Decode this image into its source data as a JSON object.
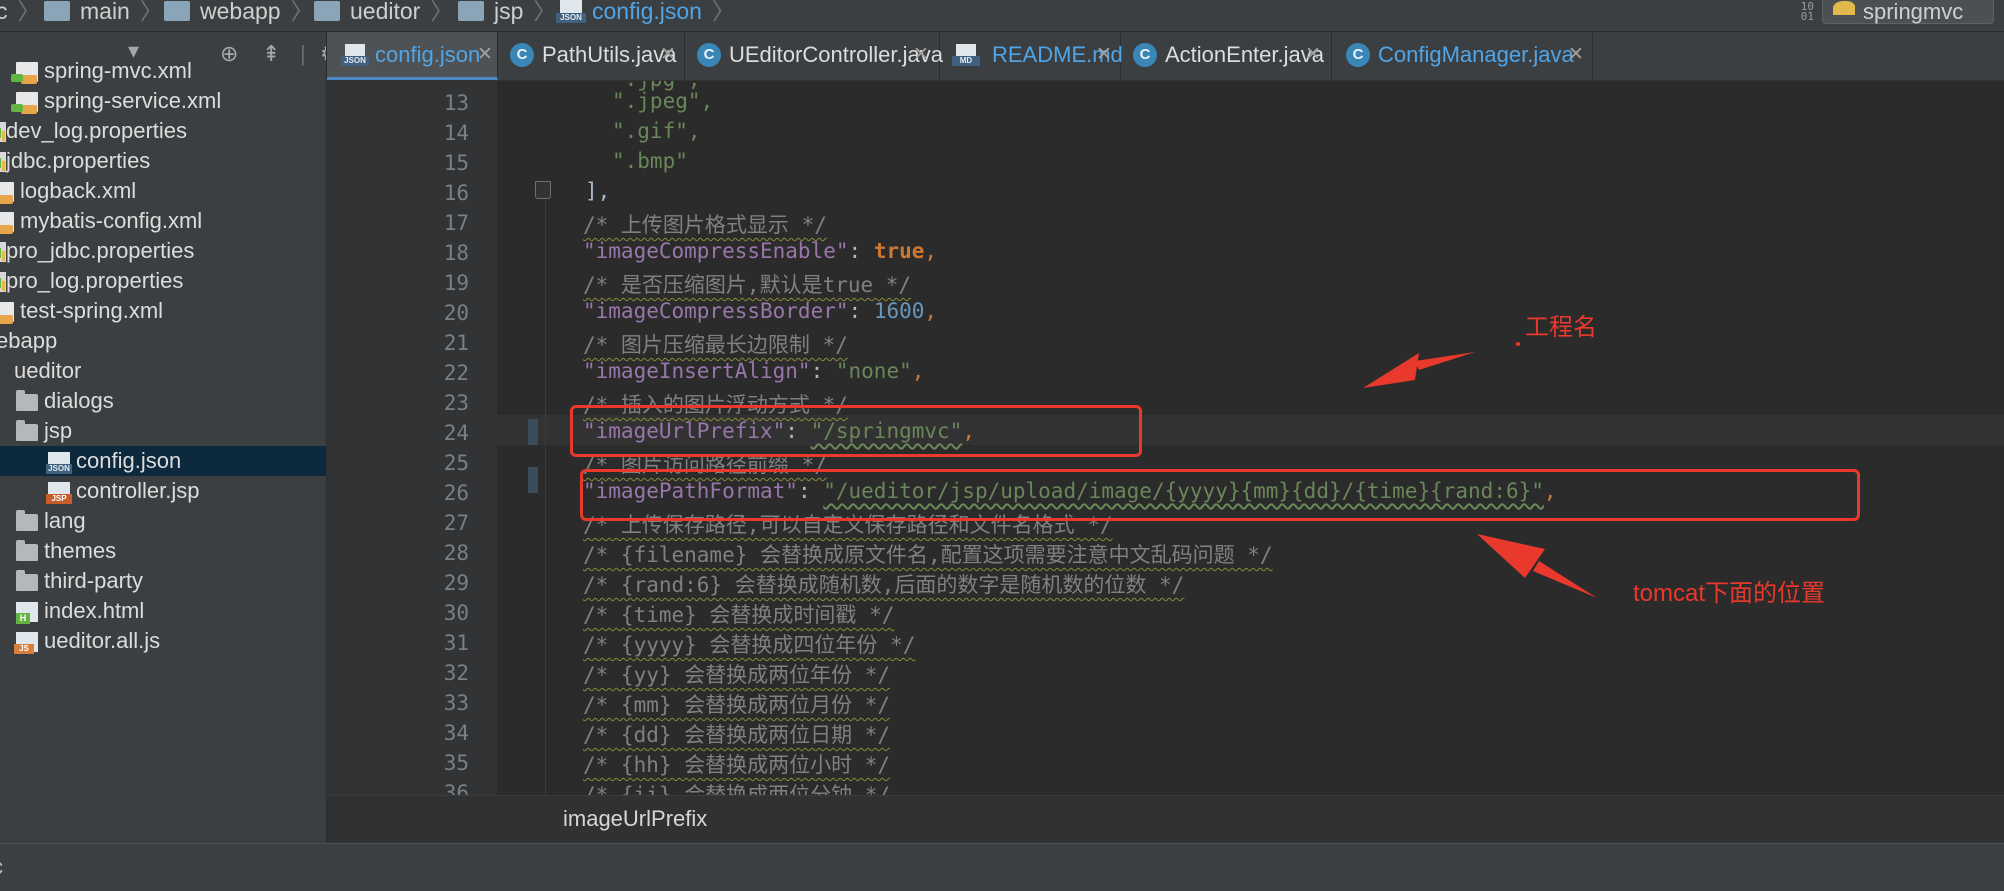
{
  "navbar": {
    "crumbs": [
      "c",
      "main",
      "webapp",
      "ueditor",
      "jsp",
      "config.json"
    ],
    "run_config": "springmvc"
  },
  "project_tree": [
    {
      "label": "spring-mvc.xml",
      "icon": "xml-file-icon",
      "indent": 1
    },
    {
      "label": "spring-service.xml",
      "icon": "xml-file-icon",
      "indent": 1
    },
    {
      "label": "dev_log.properties",
      "icon": "properties-file-icon",
      "indent": 0
    },
    {
      "label": "jdbc.properties",
      "icon": "properties-file-icon",
      "indent": 0
    },
    {
      "label": "logback.xml",
      "icon": "xml-file-icon",
      "indent": 0
    },
    {
      "label": "mybatis-config.xml",
      "icon": "xml-file-icon",
      "indent": 0
    },
    {
      "label": "pro_jdbc.properties",
      "icon": "properties-file-icon",
      "indent": 0
    },
    {
      "label": "pro_log.properties",
      "icon": "properties-file-icon",
      "indent": 0
    },
    {
      "label": "test-spring.xml",
      "icon": "xml-file-icon",
      "indent": 0
    },
    {
      "label": "ebapp",
      "icon": "none",
      "indent": -1
    },
    {
      "label": "ueditor",
      "icon": "none",
      "indent": 0
    },
    {
      "label": "dialogs",
      "icon": "folder-icon",
      "indent": 1
    },
    {
      "label": "jsp",
      "icon": "folder-icon",
      "indent": 1
    },
    {
      "label": "config.json",
      "icon": "json-file-icon",
      "indent": 2,
      "selected": true
    },
    {
      "label": "controller.jsp",
      "icon": "jsp-file-icon",
      "indent": 2
    },
    {
      "label": "lang",
      "icon": "folder-icon",
      "indent": 1
    },
    {
      "label": "themes",
      "icon": "folder-icon",
      "indent": 1
    },
    {
      "label": "third-party",
      "icon": "folder-icon",
      "indent": 1
    },
    {
      "label": "index.html",
      "icon": "html-file-icon",
      "indent": 1
    },
    {
      "label": "ueditor.all.js",
      "icon": "js-file-icon",
      "indent": 1
    }
  ],
  "tabs": [
    {
      "label": "config.json",
      "icon": "json-file-icon",
      "active": true
    },
    {
      "label": "PathUtils.java",
      "icon": "java-class-icon"
    },
    {
      "label": "UEditorController.java",
      "icon": "java-class-icon"
    },
    {
      "label": "README.md",
      "icon": "markdown-file-icon"
    },
    {
      "label": "ActionEnter.java",
      "icon": "java-class-icon"
    },
    {
      "label": "ConfigManager.java",
      "icon": "java-class-icon"
    }
  ],
  "code": {
    "line_numbers": [
      "13",
      "14",
      "15",
      "16",
      "17",
      "18",
      "19",
      "20",
      "21",
      "22",
      "23",
      "24",
      "25",
      "26",
      "27",
      "28",
      "29",
      "30",
      "31",
      "32",
      "33",
      "34",
      "35"
    ],
    "l13": "\".jpeg\",",
    "l14": "\".gif\",",
    "l15": "\".bmp\"",
    "l16": "],",
    "l17": "/* 上传图片格式显示 */",
    "l18_key": "\"imageCompressEnable\"",
    "l18_val": "true",
    "l19": "/* 是否压缩图片,默认是true */",
    "l20_key": "\"imageCompressBorder\"",
    "l20_val": "1600",
    "l21": "/* 图片压缩最长边限制 */",
    "l22_key": "\"imageInsertAlign\"",
    "l22_val": "\"none\"",
    "l23": "/* 插入的图片浮动方式 */",
    "l24_key": "\"imageUrlPrefix\"",
    "l24_val": "\"/springmvc\"",
    "l25": "/* 图片访问路径前缀 */",
    "l26_key": "\"imagePathFormat\"",
    "l26_val": "\"/ueditor/jsp/upload/image/{yyyy}{mm}{dd}/{time}{rand:6}\"",
    "l27": "/* 上传保存路径,可以自定义保存路径和文件名格式 */",
    "l28": "/* {filename} 会替换成原文件名,配置这项需要注意中文乱码问题 */",
    "l29": "/* {rand:6} 会替换成随机数,后面的数字是随机数的位数 */",
    "l30": "/* {time} 会替换成时间戳 */",
    "l31": "/* {yyyy} 会替换成四位年份 */",
    "l32": "/* {yy} 会替换成两位年份 */",
    "l33": "/* {mm} 会替换成两位月份 */",
    "l34": "/* {dd} 会替换成两位日期 */",
    "l35": "/* {hh} 会替换成两位小时 */"
  },
  "annotations": {
    "project_name_label": "工程名",
    "tomcat_label": "tomcat下面的位置"
  },
  "editor_breadcrumb": "imageUrlPrefix",
  "status": "c"
}
